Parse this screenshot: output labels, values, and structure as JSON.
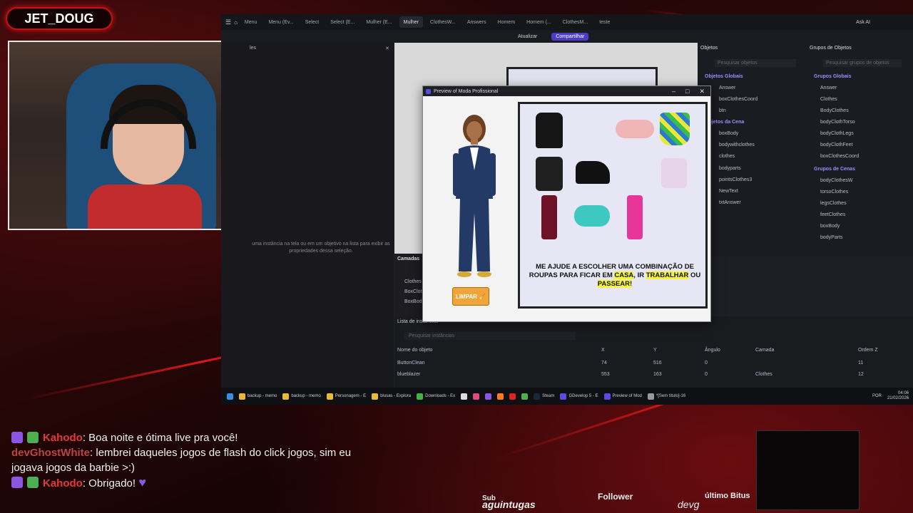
{
  "overlay": {
    "channel_name": "JET_DOUG",
    "labels": {
      "sub": "Sub",
      "sub_user": "aguintugas",
      "follower": "Follower",
      "ultimo_bits": "último Bitus",
      "ultimo_user": "devg",
      "extra": "e"
    }
  },
  "chat": [
    {
      "user": "Kahodo",
      "sep": ":",
      "msg": "Boa noite e ótima live pra você!"
    },
    {
      "user": "devGhostWhite",
      "sep": ":",
      "msg": "lembrei daqueles jogos de flash do click jogos, sim eu jogava jogos da barbie >:)"
    },
    {
      "user": "Kahodo",
      "sep": ":",
      "msg": "Obrigado!"
    }
  ],
  "editor": {
    "tabs": [
      "Menu",
      "Menu (Ev...",
      "Select",
      "Select (E...",
      "Mulher (E...",
      "Mulher",
      "ClothesW...",
      "Answers",
      "Homem",
      "Homem (...",
      "ClothesM...",
      "teste"
    ],
    "active_tab": "Mulher",
    "toolbar": {
      "update": "Atualizar",
      "share": "Compartilhar",
      "ask": "Ask AI"
    },
    "left_hint": "uma instância na tela ou em um objetivo na lista para exibir as propriedades dessa seleção.",
    "left_label": "les",
    "objects_panel": {
      "title": "Objetos",
      "search": "Pesquisar objetos",
      "global_header": "Objetos Globais",
      "global_items": [
        "Answer",
        "boxClothesCoord",
        "btn"
      ],
      "scene_header": "Objetos da Cena",
      "scene_items": [
        "boxBody",
        "bodywithclothes",
        "clothes",
        "bodyparts",
        "pointsClothes3",
        "NewText",
        "txtAnswer"
      ]
    },
    "groups_panel": {
      "title": "Grupos de Objetos",
      "search": "Pesquisar grupos de objetos",
      "global_header": "Grupos Globais",
      "global_items": [
        "Answer",
        "Clothes",
        "BodyClothes",
        "bodyClothTorso",
        "bodyClothLegs",
        "bodyClothFeet",
        "boxClothesCoord"
      ],
      "scene_header": "Grupos de Cenas",
      "scene_items": [
        "bodyClothesW",
        "torsoClothes",
        "legsClothes",
        "feetClothes",
        "boxBody",
        "bodyParts"
      ]
    },
    "layers": {
      "title": "Camadas",
      "items": [
        "Clothes",
        "BoxClot",
        "BoxBod"
      ]
    },
    "instances": {
      "title": "Lista de instâncias",
      "search": "Pesquisar instâncias",
      "headers": [
        "Nome do objeto",
        "X",
        "Y",
        "Ângulo",
        "Camada",
        "Ordem Z"
      ],
      "rows": [
        [
          "ButtonClean",
          "74",
          "516",
          "0",
          "",
          "11"
        ],
        [
          "blueblazer",
          "553",
          "163",
          "0",
          "Clothes",
          "12"
        ]
      ]
    }
  },
  "preview": {
    "title": "Preview of Moda Profissional",
    "clear_button": "LIMPAR",
    "instruction_parts": [
      "ME AJUDE A ESCOLHER UMA COMBINAÇÃO DE ROUPAS PARA FICAR EM ",
      "CASA",
      ", IR ",
      "TRABALHAR",
      " OU ",
      "PASSEAR!"
    ]
  },
  "taskbar": {
    "items": [
      "backup - memo",
      "backup - memo",
      "Personagem - E",
      "blusas - Explora",
      "Downloads - Ex",
      "Steam",
      "GDevelop 5 - E",
      "Preview of Mod",
      "*[Sem título]-16"
    ],
    "lang": "POR",
    "time": "04:06",
    "date": "21/02/2026"
  },
  "colors": {
    "accent_red": "#e01515",
    "share_purple": "#4c3cc8",
    "highlight_yellow": "#f5f53a"
  }
}
